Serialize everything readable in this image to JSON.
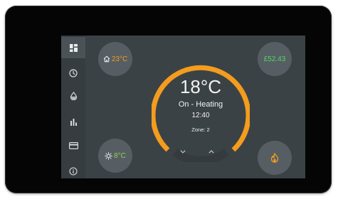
{
  "thermostat": {
    "temperature": "18°C",
    "status": "On - Heating",
    "time": "12:40",
    "zone": "Zone: 2"
  },
  "indoor": {
    "value": "23°C",
    "icon": "home-icon"
  },
  "outdoor": {
    "value": "8°C",
    "icon": "sun-icon"
  },
  "cost": {
    "value": "£52.43"
  },
  "boost": {
    "icon": "flame-icon"
  },
  "controls": {
    "down_icon": "chevron-down-icon",
    "up_icon": "chevron-up-icon"
  },
  "sidebar": {
    "items": [
      {
        "icon": "dashboard-icon",
        "active": true
      },
      {
        "icon": "clock-icon"
      },
      {
        "icon": "water-drop-icon"
      },
      {
        "icon": "bar-chart-icon"
      },
      {
        "icon": "card-icon"
      },
      {
        "icon": "info-icon"
      }
    ]
  },
  "colors": {
    "accent_orange": "#f39c1e",
    "cost_green": "#4cd964",
    "outdoor_green": "#8fd14f",
    "screen_bg": "#3b4246",
    "pill_bg": "#565e63"
  }
}
